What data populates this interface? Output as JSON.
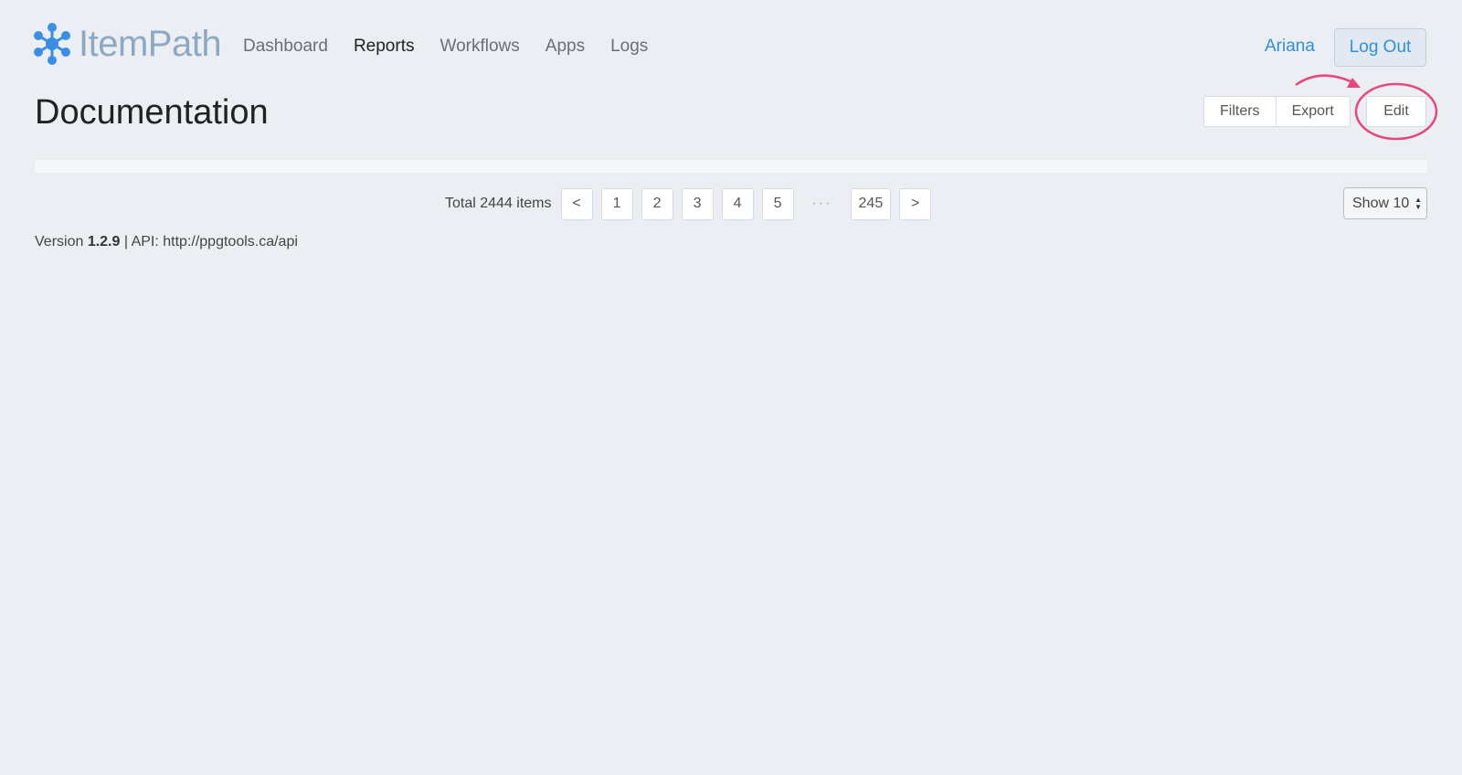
{
  "app": {
    "logo_text": "ItemPath",
    "brand_color": "#3a8fe4"
  },
  "nav": {
    "items": [
      {
        "label": "Dashboard",
        "active": false
      },
      {
        "label": "Reports",
        "active": true
      },
      {
        "label": "Workflows",
        "active": false
      },
      {
        "label": "Apps",
        "active": false
      },
      {
        "label": "Logs",
        "active": false
      }
    ]
  },
  "user": {
    "name": "Ariana",
    "logout_label": "Log Out"
  },
  "page": {
    "title": "Documentation",
    "filters_label": "Filters",
    "export_label": "Export",
    "edit_label": "Edit"
  },
  "annotation": {
    "color": "#e8467c",
    "target": "edit-button"
  },
  "pagination": {
    "total_text": "Total 2444 items",
    "prev_label": "<",
    "pages": [
      "1",
      "2",
      "3",
      "4",
      "5"
    ],
    "ellipsis": "···",
    "last_page": "245",
    "next_label": ">",
    "page_size_label": "Show 10"
  },
  "footer": {
    "version_prefix": "Version ",
    "version": "1.2.9",
    "api_text": " | API: http://ppgtools.ca/api"
  }
}
